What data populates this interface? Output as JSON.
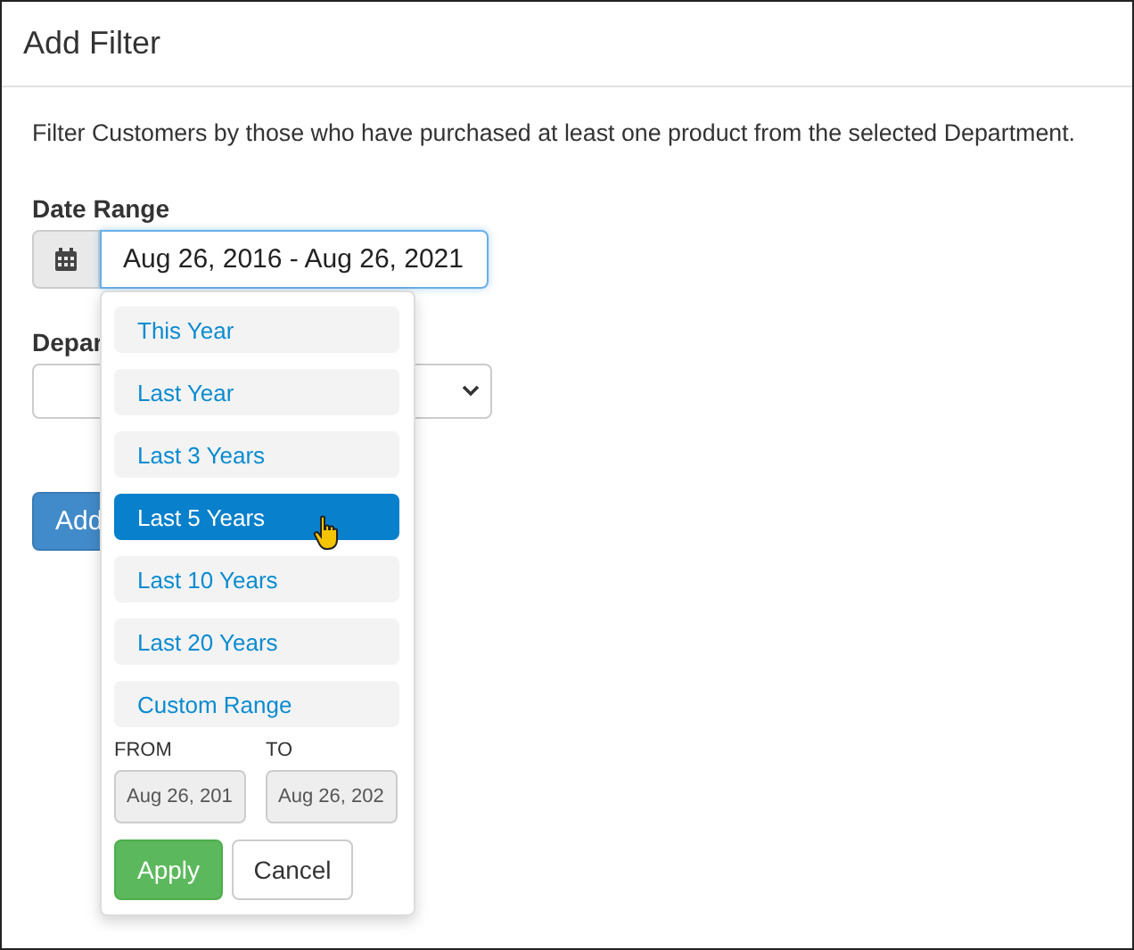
{
  "window": {
    "title": "Add Filter"
  },
  "description": "Filter Customers by those who have purchased at least one product from the selected Department.",
  "date_range": {
    "label": "Date Range",
    "value": "Aug 26, 2016 - Aug 26, 2021"
  },
  "department": {
    "label": "Depar"
  },
  "add_button": "Add",
  "picker": {
    "ranges": [
      {
        "label": "This Year",
        "selected": false
      },
      {
        "label": "Last Year",
        "selected": false
      },
      {
        "label": "Last 3 Years",
        "selected": false
      },
      {
        "label": "Last 5 Years",
        "selected": true
      },
      {
        "label": "Last 10 Years",
        "selected": false
      },
      {
        "label": "Last 20 Years",
        "selected": false
      },
      {
        "label": "Custom Range",
        "selected": false
      }
    ],
    "from": {
      "label": "FROM",
      "value": "Aug 26, 201"
    },
    "to": {
      "label": "TO",
      "value": "Aug 26, 202"
    },
    "apply": "Apply",
    "cancel": "Cancel"
  }
}
